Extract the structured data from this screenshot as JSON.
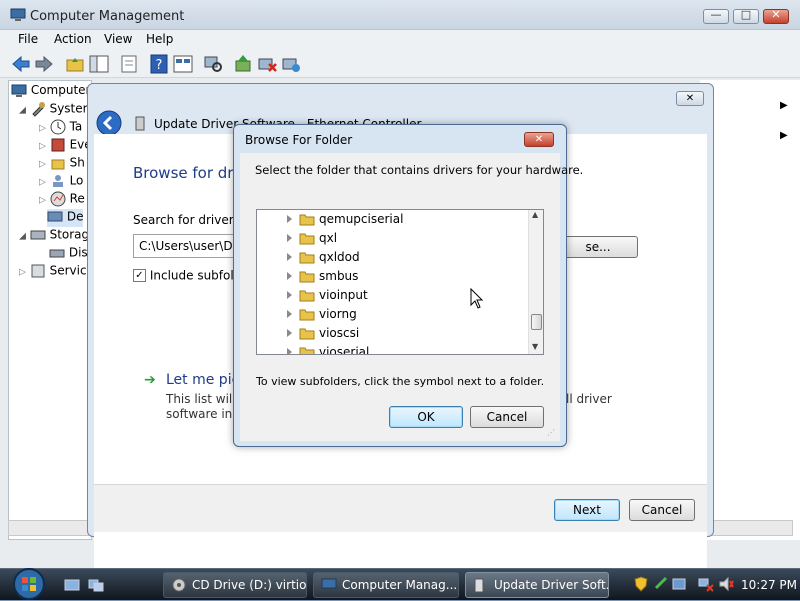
{
  "mmc": {
    "title": "Computer Management",
    "menu": [
      "File",
      "Action",
      "View",
      "Help"
    ],
    "tree": [
      {
        "label": "Computer",
        "indent": 0
      },
      {
        "label": "System",
        "indent": 1
      },
      {
        "label": "Ta",
        "indent": 2
      },
      {
        "label": "Eve",
        "indent": 2
      },
      {
        "label": "Sh",
        "indent": 2
      },
      {
        "label": "Lo",
        "indent": 2
      },
      {
        "label": "Re",
        "indent": 2
      },
      {
        "label": "De",
        "indent": 2
      },
      {
        "label": "Storag",
        "indent": 1
      },
      {
        "label": "Dis",
        "indent": 2
      },
      {
        "label": "Service",
        "indent": 1
      }
    ]
  },
  "update_driver": {
    "title": "Update Driver Software - Ethernet Controller",
    "heading": "Browse for driv",
    "search_label": "Search for driver so",
    "path_value": "C:\\Users\\user\\Doc",
    "browse_label": "se...",
    "include_subfolders": "Include subfolde",
    "pick_heading": "Let me pic",
    "pick_desc_1": "This list will s",
    "pick_desc_1b": "ll driver",
    "pick_desc_2": "software in t",
    "next_label": "Next",
    "cancel_label": "Cancel"
  },
  "browse_folder": {
    "title": "Browse For Folder",
    "instruction": "Select the folder that contains drivers for your hardware.",
    "folders": [
      "qemupciserial",
      "qxl",
      "qxldod",
      "smbus",
      "vioinput",
      "viorng",
      "vioscsi",
      "vioserial"
    ],
    "hint": "To view subfolders, click the symbol next to a folder.",
    "ok_label": "OK",
    "cancel_label": "Cancel"
  },
  "taskbar": {
    "tasks": [
      {
        "label": "CD Drive (D:) virtio..."
      },
      {
        "label": "Computer Manag..."
      },
      {
        "label": "Update Driver Soft..."
      }
    ],
    "clock": "10:27 PM"
  },
  "colors": {
    "link_blue": "#1e3c87",
    "heading_blue": "#1e3c87",
    "folder_yellow": "#e8c34a",
    "taskbar_dark": "#1b232c"
  }
}
